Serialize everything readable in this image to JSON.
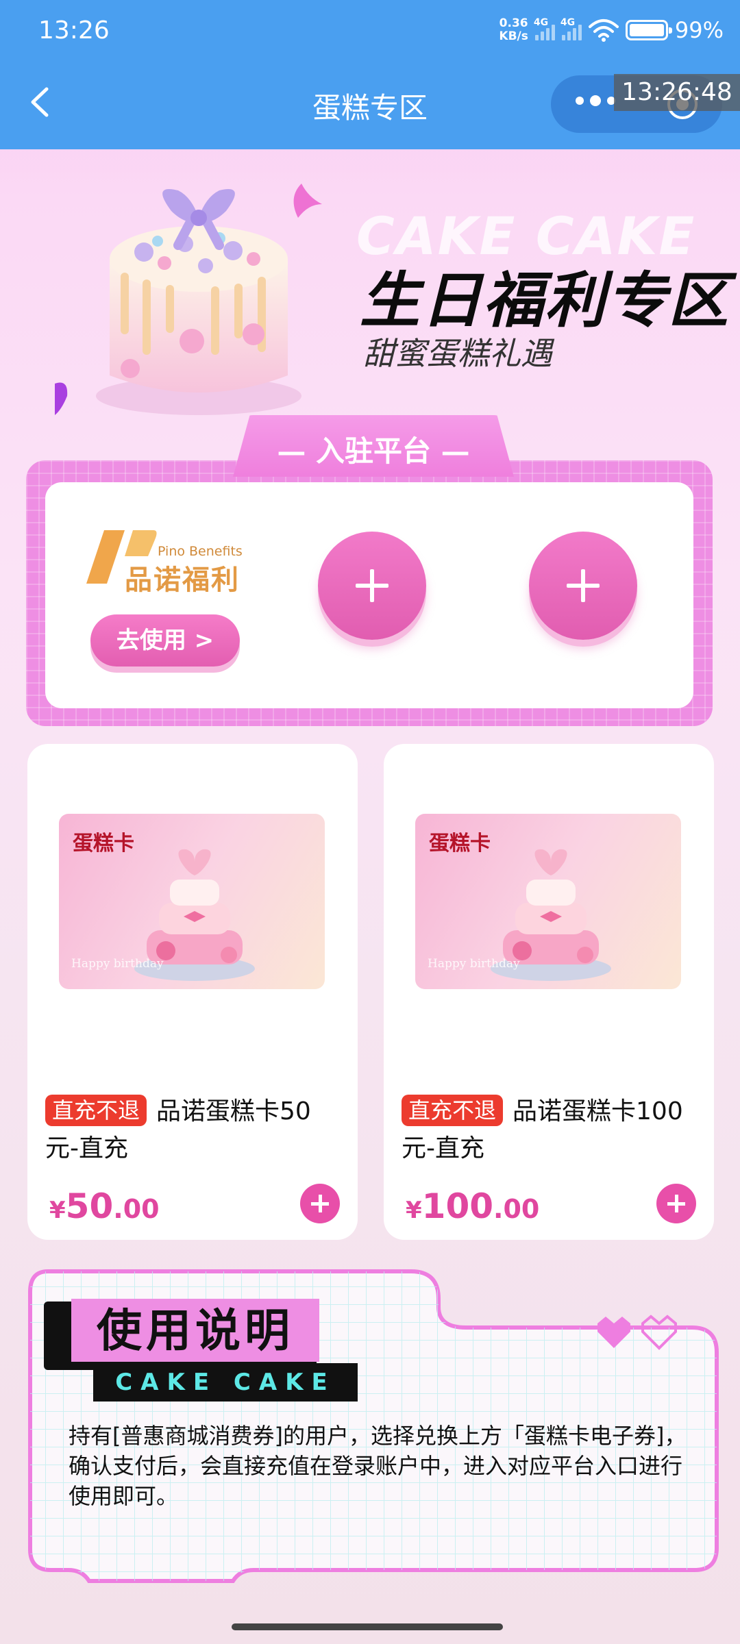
{
  "status_bar": {
    "time": "13:26",
    "net_speed_value": "0.36",
    "net_speed_unit": "KB/s",
    "signal_1_label": "4G",
    "signal_2_label": "4G",
    "battery": "99%"
  },
  "title_bar": {
    "title": "蛋糕专区",
    "clock_overlay": "13:26:48"
  },
  "hero": {
    "bg_word": "CAKE CAKE",
    "title": "生日福利专区",
    "subtitle": "甜蜜蛋糕礼遇"
  },
  "platform": {
    "tab_label": "— 入驻平台 —",
    "logo_en": "Pino Benefits",
    "logo_cn": "品诺福利",
    "use_button": "去使用 >"
  },
  "products": [
    {
      "image_label": "蛋糕卡",
      "image_happy": "Happy birthday",
      "tag": "直充不退",
      "name": "品诺蛋糕卡50元-直充",
      "currency": "¥",
      "price_int": "50",
      "price_dec": ".00"
    },
    {
      "image_label": "蛋糕卡",
      "image_happy": "Happy birthday",
      "tag": "直充不退",
      "name": "品诺蛋糕卡100元-直充",
      "currency": "¥",
      "price_int": "100",
      "price_dec": ".00"
    }
  ],
  "instructions": {
    "title": "使用说明",
    "subtitle": "CAKE CAKE",
    "text": "持有[普惠商城消费券]的用户，选择兑换上方「蛋糕卡电子券]，确认支付后，会直接充值在登录账户中，进入对应平台入口进行使用即可。"
  },
  "colors": {
    "title_bar": "#4a9ff0",
    "accent_pink": "#e84fa9",
    "tag_red": "#ec3b2e"
  }
}
